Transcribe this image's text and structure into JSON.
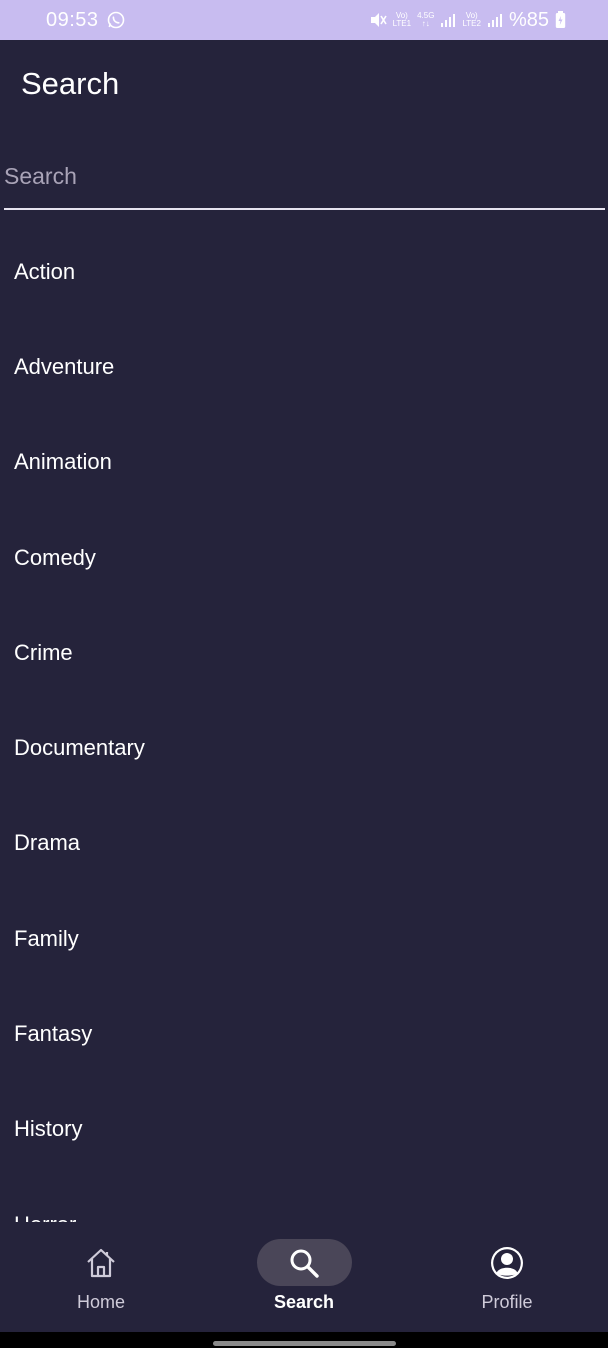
{
  "status_bar": {
    "time": "09:53",
    "sim1_top": "Vo)",
    "sim1_bottom": "LTE1",
    "network": "4.5G",
    "sim2_top": "Vo)",
    "sim2_bottom": "LTE2",
    "battery": "%85"
  },
  "header": {
    "title": "Search"
  },
  "search": {
    "placeholder": "Search",
    "value": ""
  },
  "genres": [
    "Action",
    "Adventure",
    "Animation",
    "Comedy",
    "Crime",
    "Documentary",
    "Drama",
    "Family",
    "Fantasy",
    "History",
    "Horror"
  ],
  "bottom_nav": {
    "items": [
      {
        "label": "Home",
        "icon": "home-icon",
        "active": false
      },
      {
        "label": "Search",
        "icon": "search-icon",
        "active": true
      },
      {
        "label": "Profile",
        "icon": "profile-icon",
        "active": false
      }
    ]
  },
  "colors": {
    "background": "#25233b",
    "status_bar": "#c8bcf0",
    "active_pill": "#4a4658",
    "text": "#ffffff"
  }
}
